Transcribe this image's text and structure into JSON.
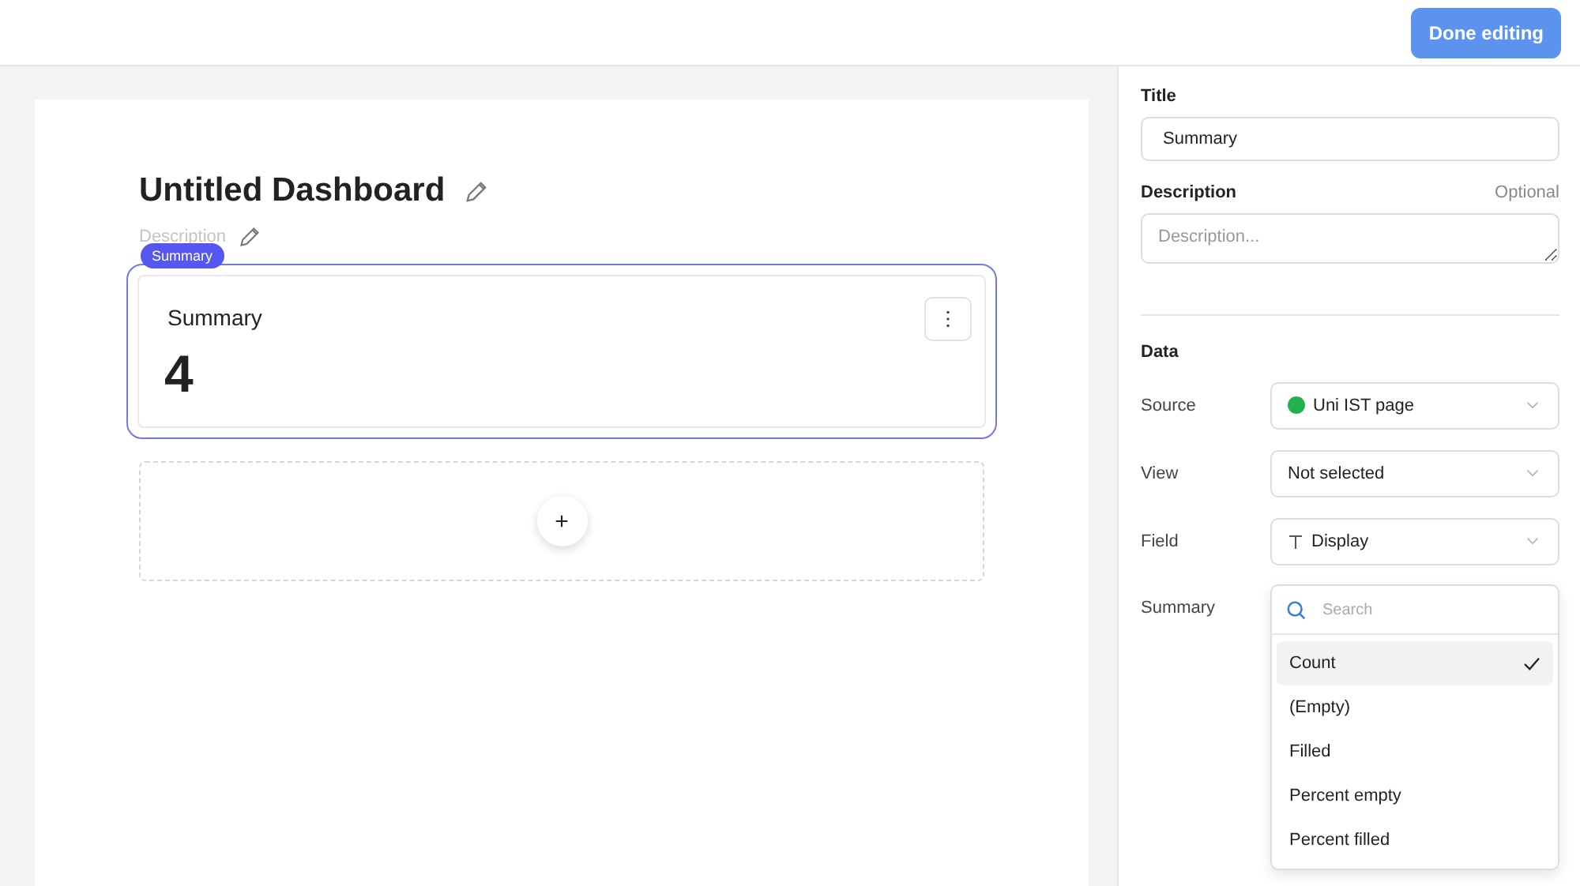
{
  "topbar": {
    "done_button": "Done editing"
  },
  "dashboard": {
    "title": "Untitled Dashboard",
    "description_placeholder": "Description",
    "widget": {
      "badge": "Summary",
      "title": "Summary",
      "value": "4",
      "selected": true
    },
    "add_button": "+"
  },
  "panel": {
    "title_label": "Title",
    "title_value": "Summary",
    "description_label": "Description",
    "description_hint": "Optional",
    "description_placeholder": "Description...",
    "data_heading": "Data",
    "rows": [
      {
        "label": "Source",
        "value": "Uni IST page",
        "kind": "source",
        "color": "#22b14c"
      },
      {
        "label": "View",
        "value": "Not selected",
        "kind": "plain"
      },
      {
        "label": "Field",
        "value": "Display",
        "kind": "text-field"
      }
    ],
    "summary_label": "Summary",
    "menu": {
      "search_placeholder": "Search",
      "options": [
        {
          "label": "Count",
          "selected": true
        },
        {
          "label": "(Empty)",
          "selected": false
        },
        {
          "label": "Filled",
          "selected": false
        },
        {
          "label": "Percent empty",
          "selected": false
        },
        {
          "label": "Percent filled",
          "selected": false
        }
      ]
    }
  }
}
